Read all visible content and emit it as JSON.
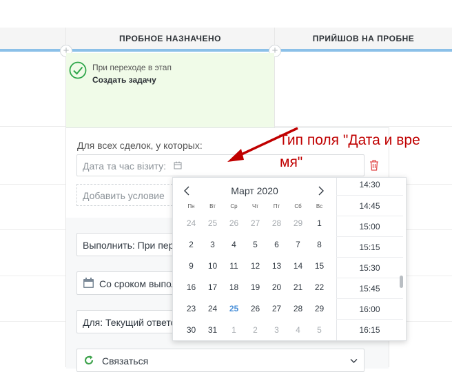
{
  "columns": [
    {
      "label": "ПРОБНОЕ НАЗНАЧЕНО"
    },
    {
      "label": "ПРИЙШОВ НА ПРОБНЕ"
    }
  ],
  "trigger": {
    "line1": "При переходе в этап",
    "line2": "Создать задачу"
  },
  "condition": {
    "label": "Для всех сделок, у которых:",
    "field_placeholder": "Дата та час візиту:",
    "add_condition": "Добавить условие"
  },
  "form": {
    "execute": "Выполнить: При переходе в этап",
    "deadline": "Со сроком выполнения",
    "for_user": "Для: Текущий ответственный",
    "task_type": "Связаться"
  },
  "calendar": {
    "month": "Март 2020",
    "weekdays": [
      "Пн",
      "Вт",
      "Ср",
      "Чт",
      "Пт",
      "Сб",
      "Вс"
    ],
    "weeks": [
      [
        "24",
        "25",
        "26",
        "27",
        "28",
        "29",
        "1"
      ],
      [
        "2",
        "3",
        "4",
        "5",
        "6",
        "7",
        "8"
      ],
      [
        "9",
        "10",
        "11",
        "12",
        "13",
        "14",
        "15"
      ],
      [
        "16",
        "17",
        "18",
        "19",
        "20",
        "21",
        "22"
      ],
      [
        "23",
        "24",
        "25",
        "26",
        "27",
        "28",
        "29"
      ],
      [
        "30",
        "31",
        "1",
        "2",
        "3",
        "4",
        "5"
      ]
    ],
    "today": "25"
  },
  "times": [
    "14:30",
    "14:45",
    "15:00",
    "15:15",
    "15:30",
    "15:45",
    "16:00",
    "16:15"
  ],
  "annotation": {
    "line1": "Тип поля \"Дата и вре",
    "line2": "мя\""
  },
  "colors": {
    "accent": "#4a90d9",
    "annotation": "#c00000",
    "trigger_bg": "#f0fbe8"
  }
}
